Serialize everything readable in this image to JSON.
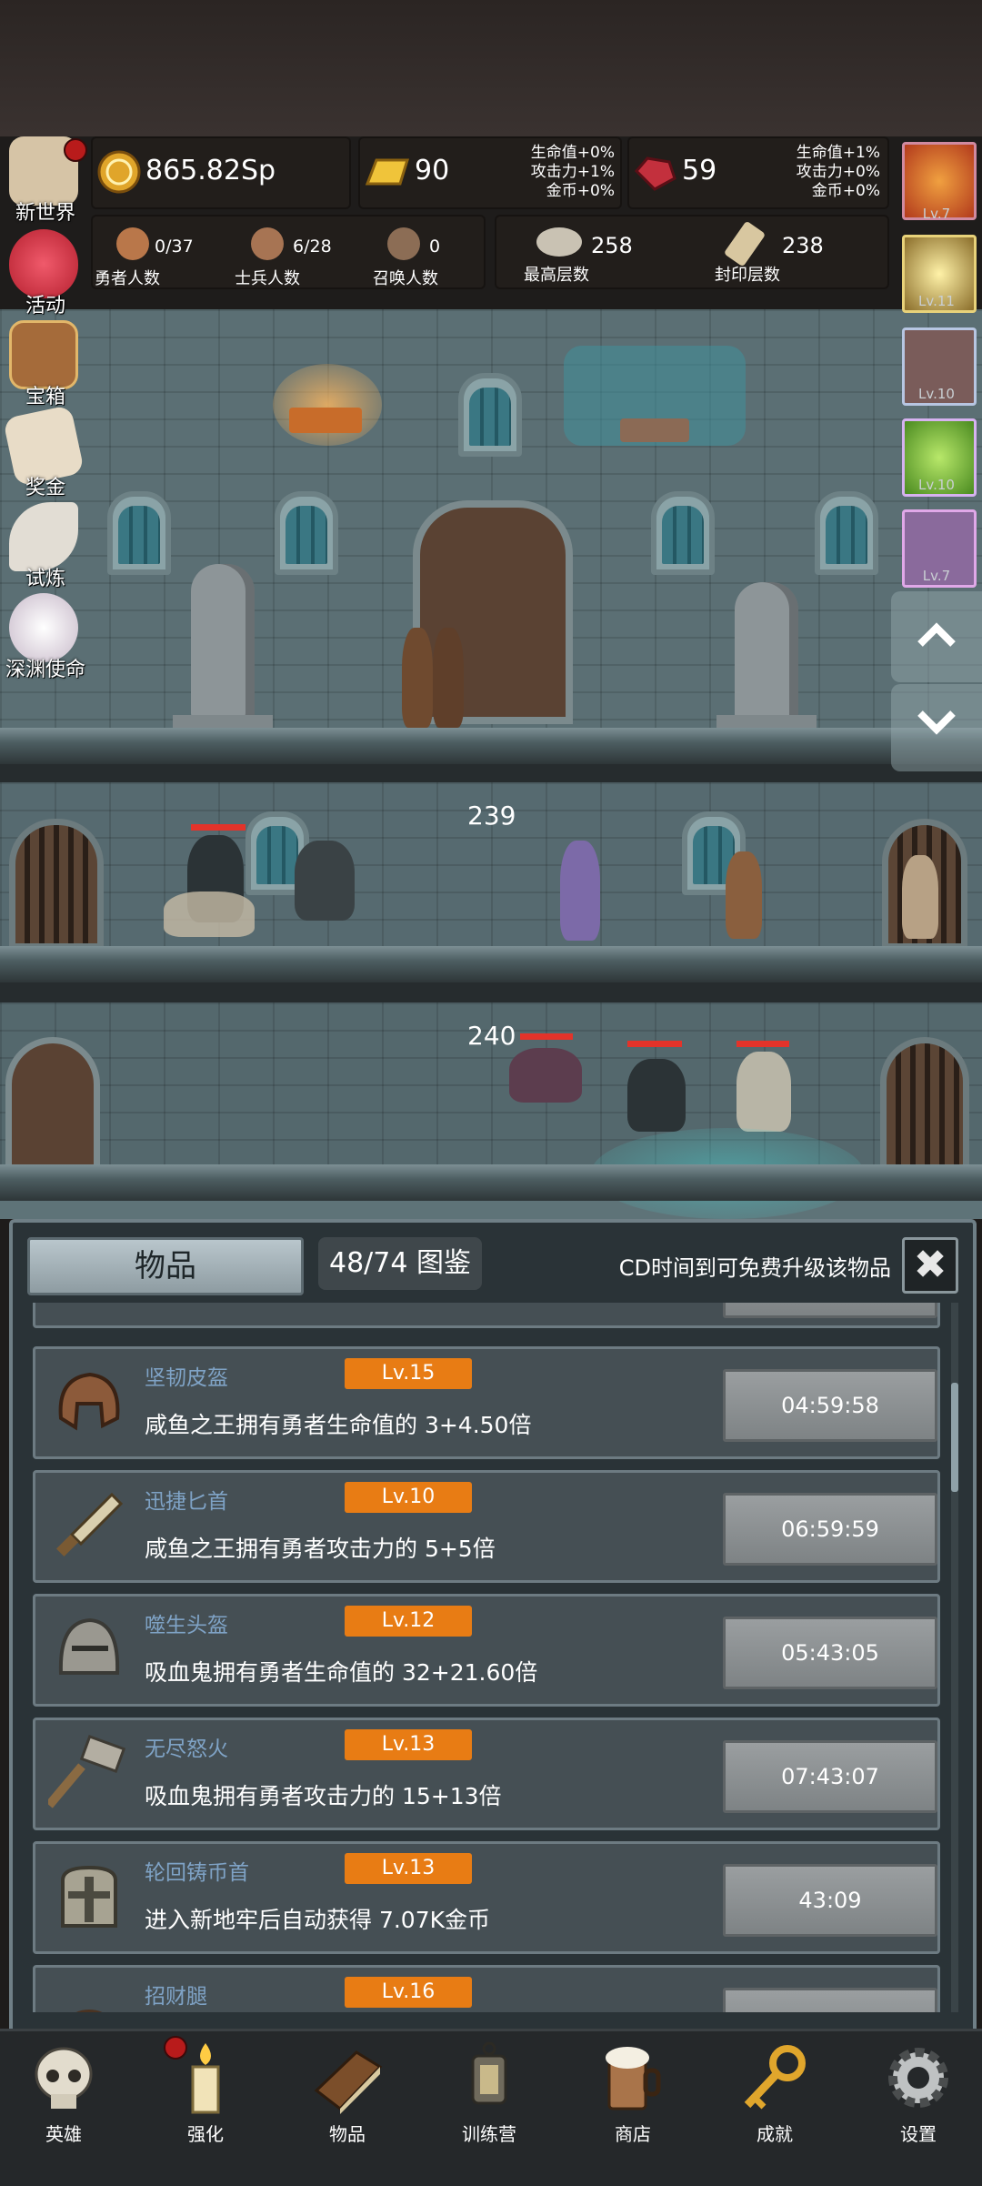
{
  "resources": {
    "gold": "865.82Sp",
    "gold_bar": "90",
    "gold_bar_bonus": [
      "生命值+0%",
      "攻击力+1%",
      "金币+0%"
    ],
    "ruby": "59",
    "ruby_bonus": [
      "生命值+1%",
      "攻击力+0%",
      "金币+0%"
    ]
  },
  "counts": {
    "heroes": {
      "value": "0/37",
      "label": "勇者人数"
    },
    "soldiers": {
      "value": "6/28",
      "label": "士兵人数"
    },
    "summons": {
      "value": "0",
      "label": "召唤人数"
    },
    "max_floor": {
      "value": "258",
      "label": "最高层数"
    },
    "sealed_floor": {
      "value": "238",
      "label": "封印层数"
    }
  },
  "side_menu": [
    {
      "label": "新世界",
      "icon": "map-scroll-icon"
    },
    {
      "label": "活动",
      "icon": "heart-icon"
    },
    {
      "label": "宝箱",
      "icon": "treasure-chest-icon"
    },
    {
      "label": "奖金",
      "icon": "envelope-icon"
    },
    {
      "label": "试炼",
      "icon": "feather-icon"
    },
    {
      "label": "深渊使命",
      "icon": "pearl-icon"
    }
  ],
  "hero_portraits": [
    {
      "level": "Lv.7"
    },
    {
      "level": "Lv.11"
    },
    {
      "level": "Lv.10"
    },
    {
      "level": "Lv.10"
    },
    {
      "level": "Lv.7"
    }
  ],
  "scene": {
    "floors": [
      "239",
      "240"
    ]
  },
  "panel": {
    "tab": "物品",
    "codex": "48/74 图鉴",
    "cd_text": "CD时间到可免费升级该物品",
    "items": [
      {
        "name": "坚韧皮盔",
        "level": "Lv.15",
        "desc": "咸鱼之王拥有勇者生命值的 3+4.50倍",
        "timer": "04:59:58",
        "icon": "leather-helmet-icon"
      },
      {
        "name": "迅捷匕首",
        "level": "Lv.10",
        "desc": "咸鱼之王拥有勇者攻击力的 5+5倍",
        "timer": "06:59:59",
        "icon": "dagger-icon"
      },
      {
        "name": "噬生头盔",
        "level": "Lv.12",
        "desc": "吸血鬼拥有勇者生命值的 32+21.60倍",
        "timer": "05:43:05",
        "icon": "knight-helmet-icon"
      },
      {
        "name": "无尽怒火",
        "level": "Lv.13",
        "desc": "吸血鬼拥有勇者攻击力的 15+13倍",
        "timer": "07:43:07",
        "icon": "hammer-icon"
      },
      {
        "name": "轮回铸币首",
        "level": "Lv.13",
        "desc": "进入新地牢后自动获得 7.07K金币",
        "timer": "43:09",
        "icon": "great-helm-icon"
      },
      {
        "name": "招财腿",
        "level": "Lv.16",
        "desc": "",
        "timer": "",
        "icon": "leg-armor-icon"
      }
    ]
  },
  "bottom_nav": [
    {
      "label": "英雄",
      "icon": "skull-icon"
    },
    {
      "label": "强化",
      "icon": "candle-icon"
    },
    {
      "label": "物品",
      "icon": "book-icon"
    },
    {
      "label": "训练营",
      "icon": "lantern-icon"
    },
    {
      "label": "商店",
      "icon": "beer-mug-icon"
    },
    {
      "label": "成就",
      "icon": "key-icon"
    },
    {
      "label": "设置",
      "icon": "gear-icon"
    }
  ],
  "colors": {
    "level_badge": "#e87c14",
    "item_name": "#7fa3c6",
    "hp_bar": "#e3332a"
  }
}
